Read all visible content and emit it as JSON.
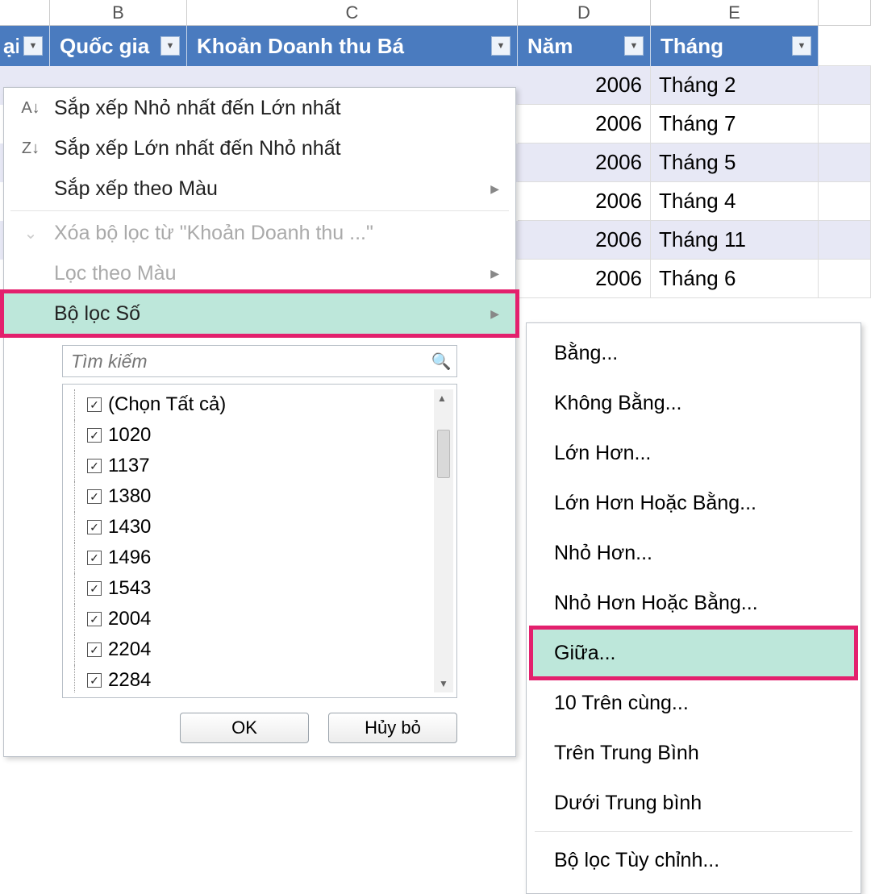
{
  "columns": {
    "letters": [
      "",
      "B",
      "C",
      "D",
      "E",
      ""
    ],
    "widths": [
      62,
      170,
      410,
      165,
      208,
      65
    ]
  },
  "headers": {
    "a_tail": "ại",
    "b": "Quốc gia",
    "c": "Khoản Doanh thu Bá",
    "d": "Năm",
    "e": "Tháng"
  },
  "data_rows": [
    {
      "year": "2006",
      "month": "Tháng 2"
    },
    {
      "year": "2006",
      "month": "Tháng 7"
    },
    {
      "year": "2006",
      "month": "Tháng 5"
    },
    {
      "year": "2006",
      "month": "Tháng 4"
    },
    {
      "year": "2006",
      "month": "Tháng 11"
    },
    {
      "year": "2006",
      "month": "Tháng 6"
    }
  ],
  "filter_menu": {
    "sort_asc": "Sắp xếp Nhỏ nhất đến Lớn nhất",
    "sort_desc": "Sắp xếp Lớn nhất đến Nhỏ nhất",
    "sort_color": "Sắp xếp theo Màu",
    "clear": "Xóa bộ lọc từ \"Khoản Doanh thu ...\"",
    "filter_color": "Lọc theo Màu",
    "number_filters": "Bộ lọc Số",
    "search_placeholder": "Tìm kiếm",
    "select_all": "(Chọn Tất cả)",
    "values": [
      "1020",
      "1137",
      "1380",
      "1430",
      "1496",
      "1543",
      "2004",
      "2204",
      "2284"
    ],
    "ok": "OK",
    "cancel": "Hủy bỏ"
  },
  "submenu": {
    "equals": "Bằng...",
    "not_equals": "Không Bằng...",
    "greater": "Lớn Hơn...",
    "greater_eq": "Lớn Hơn Hoặc Bằng...",
    "less": "Nhỏ Hơn...",
    "less_eq": "Nhỏ Hơn Hoặc Bằng...",
    "between": "Giữa...",
    "top10": "10 Trên cùng...",
    "above_avg": "Trên Trung Bình",
    "below_avg": "Dưới Trung bình",
    "custom": "Bộ lọc Tùy chỉnh..."
  }
}
